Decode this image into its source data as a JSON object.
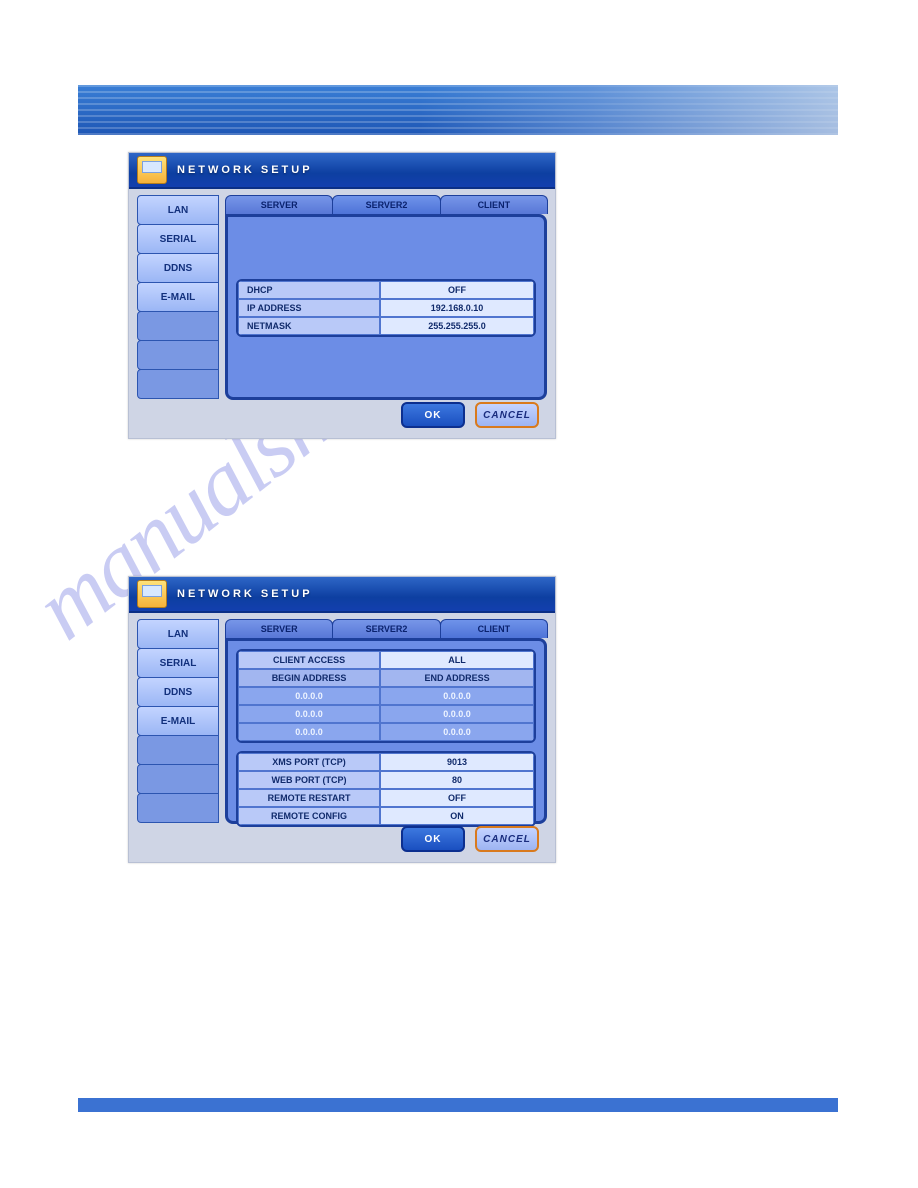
{
  "watermark_text": "manualshive.com",
  "dialog1": {
    "title": "NETWORK SETUP",
    "sidebar": {
      "items": [
        {
          "label": "LAN"
        },
        {
          "label": "SERIAL"
        },
        {
          "label": "DDNS"
        },
        {
          "label": "E-MAIL"
        }
      ]
    },
    "tabs": [
      {
        "label": "SERVER"
      },
      {
        "label": "SERVER2"
      },
      {
        "label": "CLIENT"
      }
    ],
    "active_tab": 1,
    "rows": [
      {
        "label": "DHCP",
        "value": "OFF"
      },
      {
        "label": "IP ADDRESS",
        "value": "192.168.0.10"
      },
      {
        "label": "NETMASK",
        "value": "255.255.255.0"
      }
    ],
    "buttons": {
      "ok": "OK",
      "cancel": "CANCEL"
    }
  },
  "dialog2": {
    "title": "NETWORK SETUP",
    "sidebar": {
      "items": [
        {
          "label": "LAN"
        },
        {
          "label": "SERIAL"
        },
        {
          "label": "DDNS"
        },
        {
          "label": "E-MAIL"
        }
      ]
    },
    "tabs": [
      {
        "label": "SERVER"
      },
      {
        "label": "SERVER2"
      },
      {
        "label": "CLIENT"
      }
    ],
    "active_tab": 2,
    "client_access": {
      "label": "CLIENT ACCESS",
      "value": "ALL",
      "col_begin": "BEGIN ADDRESS",
      "col_end": "END ADDRESS",
      "rows": [
        {
          "begin": "0.0.0.0",
          "end": "0.0.0.0"
        },
        {
          "begin": "0.0.0.0",
          "end": "0.0.0.0"
        },
        {
          "begin": "0.0.0.0",
          "end": "0.0.0.0"
        }
      ]
    },
    "settings": [
      {
        "label": "XMS PORT (TCP)",
        "value": "9013"
      },
      {
        "label": "WEB PORT (TCP)",
        "value": "80"
      },
      {
        "label": "REMOTE RESTART",
        "value": "OFF"
      },
      {
        "label": "REMOTE CONFIG",
        "value": "ON"
      }
    ],
    "buttons": {
      "ok": "OK",
      "cancel": "CANCEL"
    }
  }
}
